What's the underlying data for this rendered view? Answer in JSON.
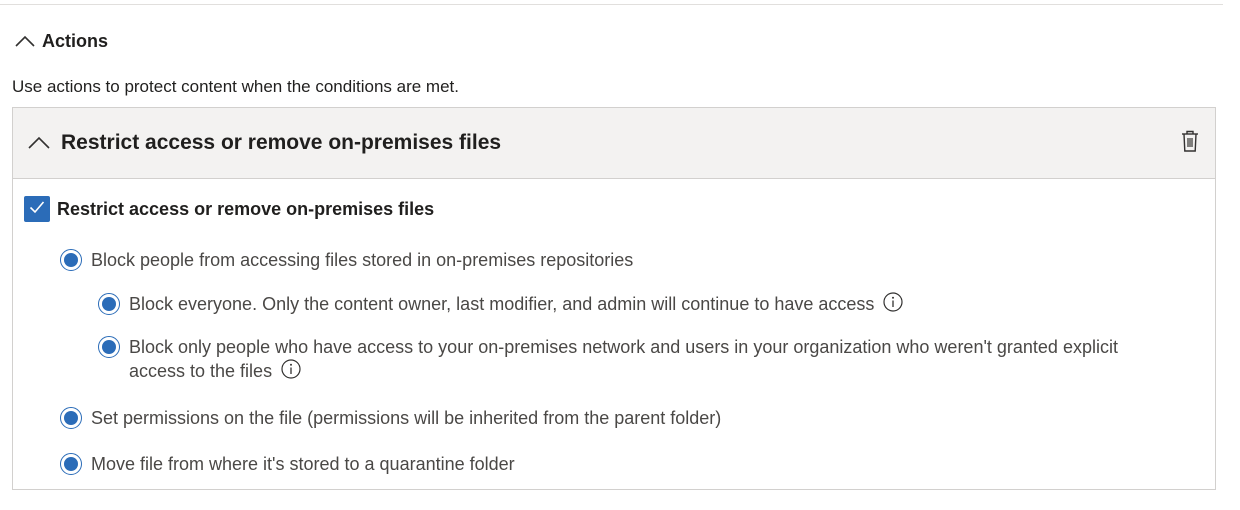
{
  "section": {
    "title": "Actions",
    "description": "Use actions to protect content when the conditions are met."
  },
  "card": {
    "title": "Restrict access or remove on-premises files",
    "delete_icon": "trash-icon",
    "checkbox": {
      "label": "Restrict access or remove on-premises files",
      "checked": true
    },
    "options": [
      {
        "label": "Block people from accessing files stored in on-premises repositories",
        "selected": true
      },
      {
        "label": "Block everyone. Only the content owner, last modifier, and admin will continue to have access",
        "selected": true,
        "info": "info-icon"
      },
      {
        "label_line1": "Block only people who have access to your on-premises network and users in your organization who weren't granted explicit",
        "label_line2": "access to the files",
        "selected": true,
        "info": "info-icon"
      },
      {
        "label": "Set permissions on the file (permissions will be inherited from the parent folder)",
        "selected": true
      },
      {
        "label": "Move file from where it's stored to a quarantine folder",
        "selected": true
      }
    ]
  },
  "colors": {
    "accent": "#2b6cb8",
    "header_bg": "#f3f2f1",
    "border": "#d2d0ce"
  }
}
